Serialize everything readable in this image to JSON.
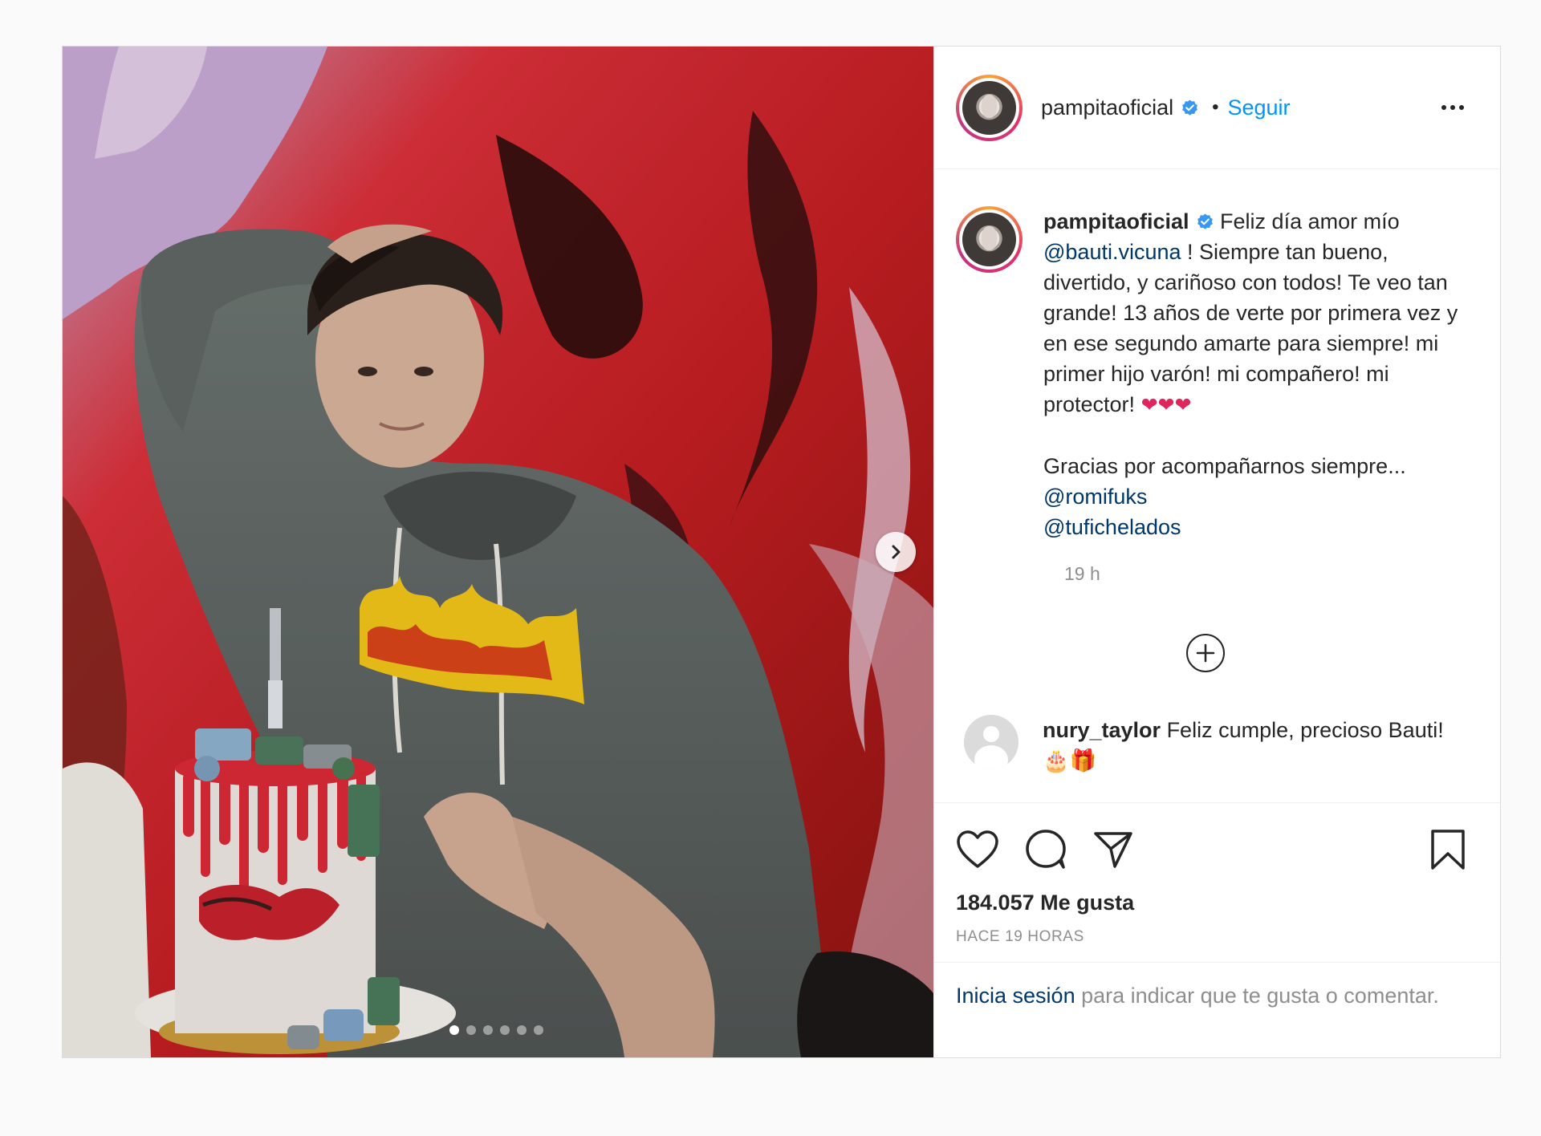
{
  "post": {
    "image_alt": "",
    "carousel": {
      "slide_count": 6,
      "active_index": 0
    }
  },
  "header": {
    "username": "pampitaoficial",
    "separator": "•",
    "follow_label": "Seguir"
  },
  "caption": {
    "username": "pampitaoficial",
    "text_1": " Feliz día amor mío ",
    "mention_1": "@bauti.vicuna",
    "text_2": " ! Siempre tan bueno, divertido, y cariñoso con todos! Te veo tan grande! 13 años de verte por primera vez y en ese segundo amarte para siempre! mi primer hijo varón! mi compañero! mi protector! ",
    "hearts": "❤❤❤",
    "text_3": "Gracias por acompañarnos siempre...",
    "mention_2": "@romifuks",
    "mention_3": "@tufichelados",
    "time": "19 h"
  },
  "comment": {
    "username": "nury_taylor",
    "text": " Feliz cumple, precioso Bauti!",
    "emojis": "🎂🎁"
  },
  "actions": {
    "icons": [
      "heart-icon",
      "comment-icon",
      "share-icon",
      "bookmark-icon"
    ],
    "likes": "184.057 Me gusta",
    "ago": "HACE 19 HORAS"
  },
  "login": {
    "link": "Inicia sesión",
    "rest": " para indicar que te gusta o comentar."
  },
  "colors": {
    "accent": "#0095f6",
    "mention": "#00376b",
    "muted": "#8e8e8e",
    "border": "#dbdbdb"
  }
}
